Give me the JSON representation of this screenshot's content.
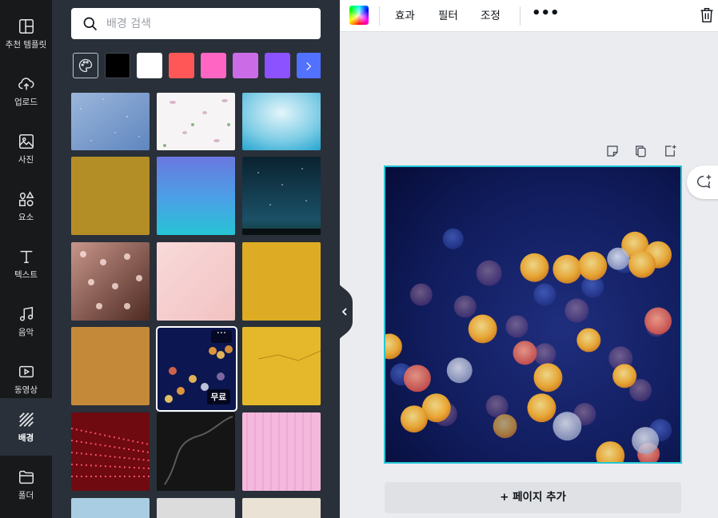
{
  "nav": {
    "items": [
      {
        "label": "추천 템플릿",
        "icon": "template-icon"
      },
      {
        "label": "업로드",
        "icon": "upload-cloud-icon"
      },
      {
        "label": "사진",
        "icon": "photo-icon"
      },
      {
        "label": "요소",
        "icon": "shapes-icon"
      },
      {
        "label": "텍스트",
        "icon": "text-icon"
      },
      {
        "label": "음악",
        "icon": "music-note-icon"
      },
      {
        "label": "동영상",
        "icon": "video-icon"
      },
      {
        "label": "배경",
        "icon": "background-pattern-icon",
        "active": true
      },
      {
        "label": "폴더",
        "icon": "folder-icon"
      }
    ]
  },
  "panel": {
    "search_placeholder": "배경 검색",
    "swatch_colors": [
      "#000000",
      "#ffffff",
      "#ff5757",
      "#ff66c4",
      "#cb6ce6",
      "#8c52ff",
      "#5271ff"
    ],
    "free_badge": "무료",
    "more_label": "···",
    "backgrounds": [
      {
        "name": "blue-glitter",
        "colors": [
          "#6f94c8",
          "#9bb6db"
        ]
      },
      {
        "name": "white-petals",
        "colors": [
          "#f7f4f6",
          "#e8dde6"
        ]
      },
      {
        "name": "light-blue-blur",
        "colors": [
          "#4fb5d8",
          "#d9f0f7"
        ]
      },
      {
        "name": "gold-texture",
        "colors": [
          "#b8922a",
          "#a07d1f"
        ]
      },
      {
        "name": "blue-ocean-gradient",
        "colors": [
          "#6b7fe0",
          "#2ec1d8"
        ]
      },
      {
        "name": "night-sky",
        "colors": [
          "#0b2736",
          "#1d4e62"
        ]
      },
      {
        "name": "hearts-bokeh",
        "colors": [
          "#b07a6a",
          "#5e3428"
        ]
      },
      {
        "name": "pink-marble",
        "colors": [
          "#f6cfcf",
          "#fae3e0"
        ]
      },
      {
        "name": "yellow-wall",
        "colors": [
          "#e9b92b",
          "#d9a520"
        ]
      },
      {
        "name": "orange-paper",
        "colors": [
          "#c5893a",
          "#b97c30"
        ]
      },
      {
        "name": "city-bokeh",
        "colors": [
          "#0b1548",
          "#1b2a70"
        ],
        "selected": true
      },
      {
        "name": "yellow-crack",
        "colors": [
          "#e4b82a",
          "#d6a91d"
        ]
      },
      {
        "name": "red-led",
        "colors": [
          "#8a0e14",
          "#ff4d6a"
        ]
      },
      {
        "name": "black-smoke",
        "colors": [
          "#1a1a1a",
          "#3d3d3d"
        ]
      },
      {
        "name": "pink-stripes",
        "colors": [
          "#f4b8dc",
          "#eaa0cf"
        ]
      },
      {
        "name": "light-blue-sky",
        "colors": [
          "#9fc6dd",
          "#c4dcea"
        ]
      },
      {
        "name": "grey-light",
        "colors": [
          "#d9d9d9",
          "#e6e6e6"
        ]
      },
      {
        "name": "sand",
        "colors": [
          "#e8e0d2",
          "#efe9de"
        ]
      }
    ]
  },
  "toolbar": {
    "color_icon": "rainbow-color-icon",
    "effects_label": "효과",
    "filter_label": "필터",
    "adjust_label": "조정",
    "more_label": "•••",
    "delete_icon": "trash-icon"
  },
  "canvas": {
    "page_icons": [
      "note-icon",
      "duplicate-page-icon",
      "add-page-icon"
    ],
    "comment_icon": "add-comment-icon",
    "selection_color": "#21c8d6",
    "add_page_label": "+ 페이지 추가"
  }
}
